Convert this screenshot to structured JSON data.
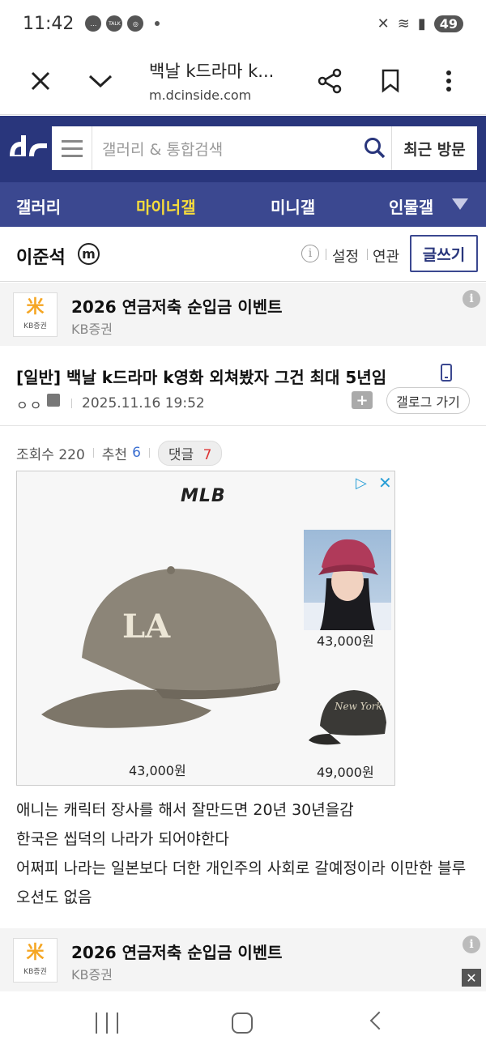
{
  "status_bar": {
    "time": "11:42",
    "talk_label": "TALK",
    "battery": "49"
  },
  "browser": {
    "page_title": "백날 k드라마 k...",
    "url": "m.dcinside.com"
  },
  "site": {
    "search_placeholder": "갤러리 & 통합검색",
    "recent_label": "최근 방문"
  },
  "nav": {
    "items": [
      "갤러리",
      "마이너갤",
      "미니갤",
      "인물갤"
    ],
    "active_color": "#f7dc3b"
  },
  "gallery": {
    "name": "이준석",
    "badge": "m",
    "info": "i",
    "settings": "설정",
    "related": "연관",
    "write": "글쓰기"
  },
  "ad_banner": {
    "logo_mark": "米",
    "logo_text": "KB증권",
    "title": "2026 연금저축 순입금 이벤트",
    "advertiser": "KB증권",
    "info": "i",
    "close": "✕"
  },
  "post": {
    "title": "[일반] 백날 k드라마 k영화 외쳐봤자 그건 최대 5년임",
    "author": "ㅇㅇ",
    "date": "2025.11.16 19:52",
    "folder_icon": "+",
    "gallog": "갤로그 가기",
    "views_label": "조회수 220",
    "recommend_label": "추천",
    "recommend_count": "6",
    "comments_label": "댓글",
    "comments_count": "7",
    "body": [
      "애니는 캐릭터 장사를 해서 잘만드면 20년 30년을감",
      "한국은 씹덕의 나라가 되어야한다",
      "어쩌피 나라는 일본보다 더한 개인주의 사회로 갈예정이라 이만한 블루오션도 없음"
    ]
  },
  "advert": {
    "brand": "MLB",
    "adchoice": "▷",
    "close": "✕",
    "price_main": "43,000원",
    "price_thumb1": "43,000원",
    "price_thumb2": "49,000원"
  }
}
